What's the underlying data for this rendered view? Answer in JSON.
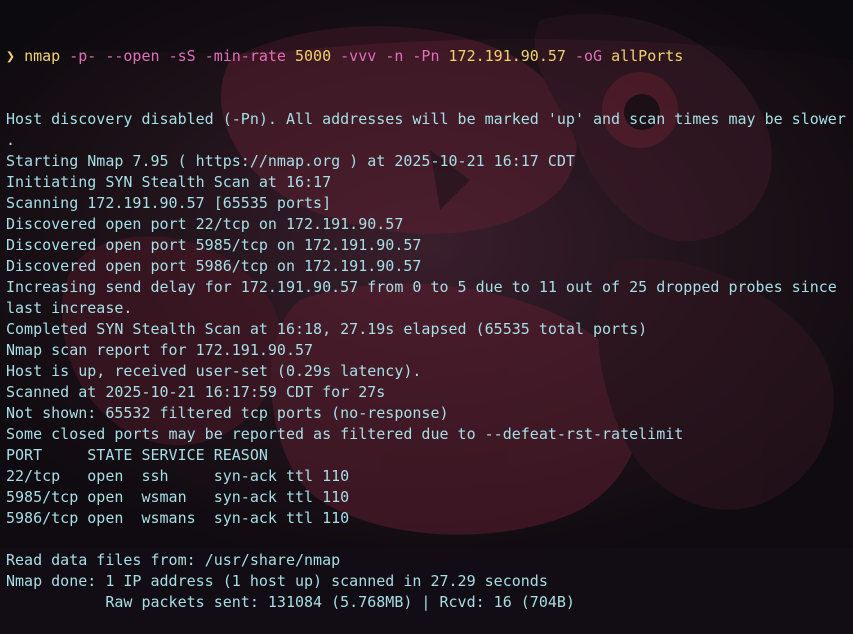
{
  "colors": {
    "background": "#120d14",
    "output_text": "#a6dfe6",
    "command_text": "#f1d46a",
    "flag_text": "#e06fb8"
  },
  "prompt": {
    "symbol": "❯",
    "command": "nmap",
    "tokens": [
      {
        "text": "-p-",
        "kind": "flag"
      },
      {
        "text": "--open",
        "kind": "flag"
      },
      {
        "text": "-sS",
        "kind": "flag"
      },
      {
        "text": "-min-rate",
        "kind": "flag"
      },
      {
        "text": "5000",
        "kind": "arg"
      },
      {
        "text": "-vvv",
        "kind": "flag"
      },
      {
        "text": "-n",
        "kind": "flag"
      },
      {
        "text": "-Pn",
        "kind": "flag"
      },
      {
        "text": "172.191.90.57",
        "kind": "arg"
      },
      {
        "text": "-oG",
        "kind": "flag"
      },
      {
        "text": "allPorts",
        "kind": "arg"
      }
    ]
  },
  "output_lines": [
    "Host discovery disabled (-Pn). All addresses will be marked 'up' and scan times may be slower",
    ".",
    "Starting Nmap 7.95 ( https://nmap.org ) at 2025-10-21 16:17 CDT",
    "Initiating SYN Stealth Scan at 16:17",
    "Scanning 172.191.90.57 [65535 ports]",
    "Discovered open port 22/tcp on 172.191.90.57",
    "Discovered open port 5985/tcp on 172.191.90.57",
    "Discovered open port 5986/tcp on 172.191.90.57",
    "Increasing send delay for 172.191.90.57 from 0 to 5 due to 11 out of 25 dropped probes since",
    "last increase.",
    "Completed SYN Stealth Scan at 16:18, 27.19s elapsed (65535 total ports)",
    "Nmap scan report for 172.191.90.57",
    "Host is up, received user-set (0.29s latency).",
    "Scanned at 2025-10-21 16:17:59 CDT for 27s",
    "Not shown: 65532 filtered tcp ports (no-response)",
    "Some closed ports may be reported as filtered due to --defeat-rst-ratelimit",
    "PORT     STATE SERVICE REASON",
    "22/tcp   open  ssh     syn-ack ttl 110",
    "5985/tcp open  wsman   syn-ack ttl 110",
    "5986/tcp open  wsmans  syn-ack ttl 110",
    "",
    "Read data files from: /usr/share/nmap",
    "Nmap done: 1 IP address (1 host up) scanned in 27.29 seconds",
    "           Raw packets sent: 131084 (5.768MB) | Rcvd: 16 (704B)"
  ]
}
